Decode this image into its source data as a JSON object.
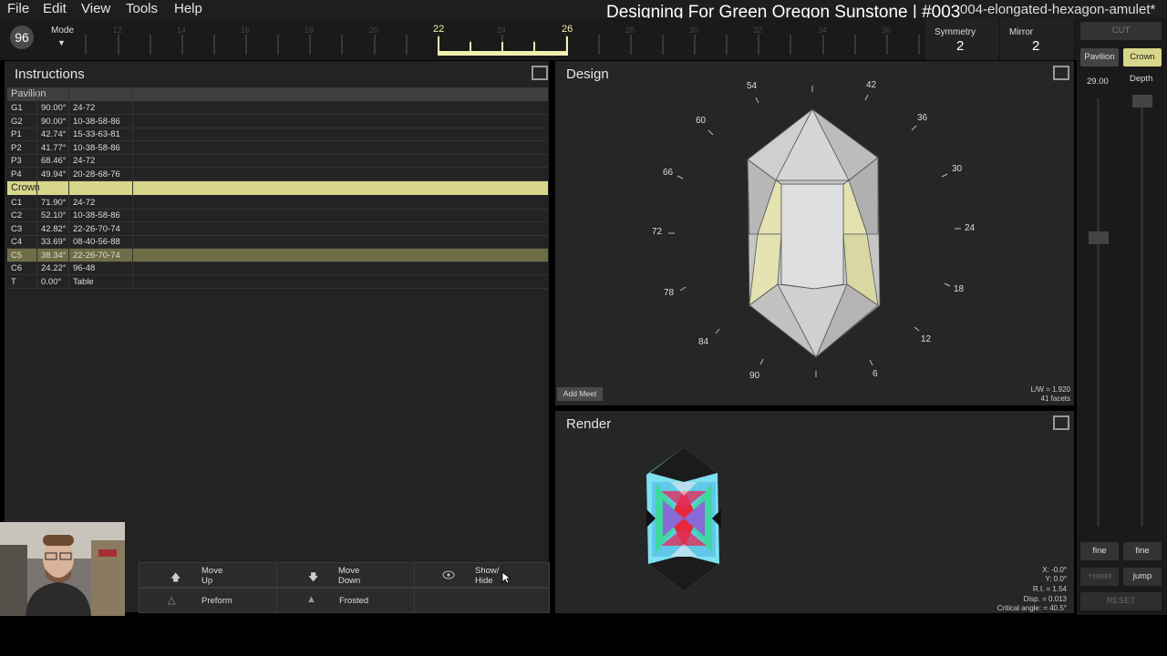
{
  "menu": {
    "file": "File",
    "edit": "Edit",
    "view": "View",
    "tools": "Tools",
    "help": "Help"
  },
  "video_title": "Designing For Green Oregon Sunstone | #003",
  "doc_title": "004-elongated-hexagon-amulet*",
  "topbar": {
    "resolution": "96",
    "mode_label": "Mode",
    "ruler_labels": [
      "12",
      "14",
      "16",
      "18",
      "20",
      "22",
      "24",
      "26",
      "28",
      "30",
      "32",
      "34",
      "36"
    ],
    "selected_start": "22",
    "selected_end": "26",
    "symmetry_label": "Symmetry",
    "symmetry_value": "2",
    "mirror_label": "Mirror",
    "mirror_value": "2"
  },
  "instructions": {
    "title": "Instructions",
    "pavilion_header": "Pavilion",
    "pavilion_rows": [
      {
        "name": "G1",
        "angle": "90.00°",
        "indices": "24-72"
      },
      {
        "name": "G2",
        "angle": "90.00°",
        "indices": "10-38-58-86"
      },
      {
        "name": "P1",
        "angle": "42.74°",
        "indices": "15-33-63-81"
      },
      {
        "name": "P2",
        "angle": "41.77°",
        "indices": "10-38-58-86"
      },
      {
        "name": "P3",
        "angle": "68.46°",
        "indices": "24-72"
      },
      {
        "name": "P4",
        "angle": "49.94°",
        "indices": "20-28-68-76"
      }
    ],
    "crown_header": "Crown",
    "crown_rows": [
      {
        "name": "C1",
        "angle": "71.90°",
        "indices": "24-72"
      },
      {
        "name": "C2",
        "angle": "52.10°",
        "indices": "10-38-58-86"
      },
      {
        "name": "C3",
        "angle": "42.82°",
        "indices": "22-26-70-74"
      },
      {
        "name": "C4",
        "angle": "33.69°",
        "indices": "08-40-56-88"
      },
      {
        "name": "C5",
        "angle": "38.34°",
        "indices": "22-26-70-74"
      },
      {
        "name": "C6",
        "angle": "24.22°",
        "indices": "96-48"
      },
      {
        "name": "T",
        "angle": "0.00°",
        "indices": "Table"
      }
    ]
  },
  "buttons": {
    "move_up_1": "Move",
    "move_up_2": "Up",
    "move_down_1": "Move",
    "move_down_2": "Down",
    "show_hide_1": "Show/",
    "show_hide_2": "Hide",
    "preform": "Preform",
    "frosted": "Frosted"
  },
  "design": {
    "title": "Design",
    "dial": [
      "54",
      "42",
      "60",
      "36",
      "66",
      "30",
      "72",
      "24",
      "78",
      "18",
      "84",
      "12",
      "90",
      "6"
    ],
    "add_meet": "Add Meet",
    "lw": "L/W = 1.920",
    "facets": "41 facets"
  },
  "render": {
    "title": "Render",
    "x": "X: -0.0°",
    "y": "Y: 0.0°",
    "ri": "R.I. = 1.54",
    "disp": "Disp. = 0.013",
    "crit": "Critical angle: = 40.5°"
  },
  "right": {
    "cut": "CUT",
    "pavilion": "Pavilion",
    "crown": "Crown",
    "angle_value": "29.00",
    "depth_label": "Depth",
    "fine_left": "fine",
    "fine_right": "fine",
    "meet": "+meet",
    "jump": "jump",
    "reset": "RESET"
  },
  "colors": {
    "accent": "#f2f0b0",
    "crown_highlight": "#d8d68a",
    "selected_row": "#6f6d45"
  }
}
